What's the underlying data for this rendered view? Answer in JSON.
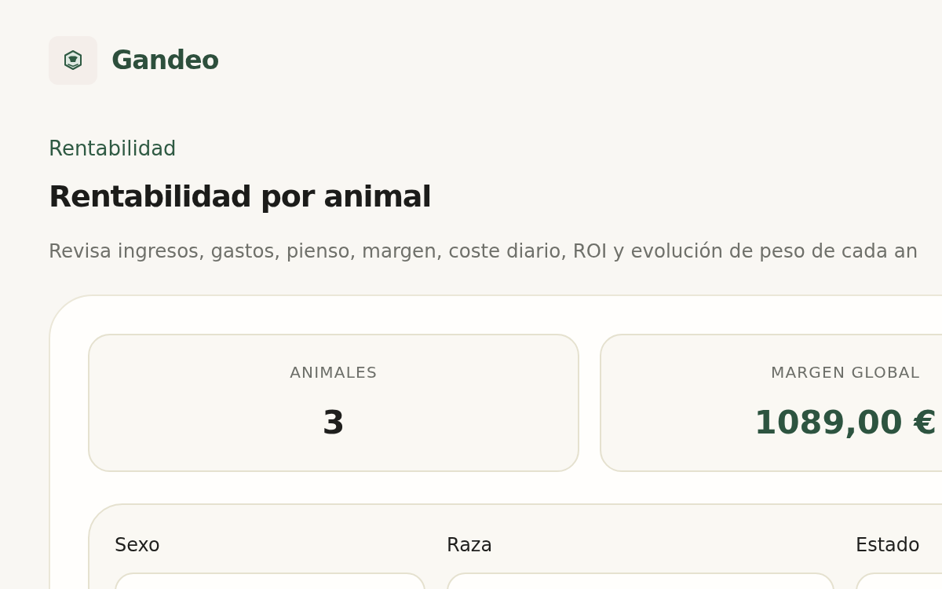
{
  "brand": {
    "name": "Gandeo"
  },
  "header": {
    "eyebrow": "Rentabilidad",
    "title": "Rentabilidad por animal",
    "subtitle": "Revisa ingresos, gastos, pienso, margen, coste diario, ROI y evolución de peso de cada an"
  },
  "stats": [
    {
      "label": "ANIMALES",
      "value": "3",
      "color": "#1f1f1d"
    },
    {
      "label": "MARGEN GLOBAL",
      "value": "1089,00 €",
      "color": "#2d5440"
    }
  ],
  "filters": [
    {
      "label": "Sexo"
    },
    {
      "label": "Raza"
    },
    {
      "label": "Estado"
    }
  ]
}
